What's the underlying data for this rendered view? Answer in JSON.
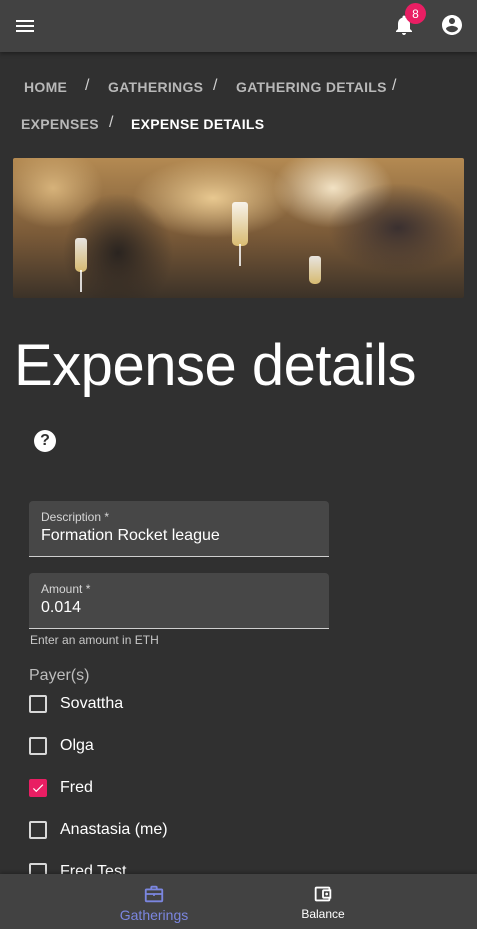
{
  "app": {
    "notification_count": "8"
  },
  "breadcrumb": [
    {
      "label": "HOME"
    },
    {
      "label": "GATHERINGS"
    },
    {
      "label": "GATHERING DETAILS"
    },
    {
      "label": "EXPENSES"
    },
    {
      "label": "EXPENSE DETAILS"
    }
  ],
  "breadcrumb_separator": "/",
  "page": {
    "title": "Expense details",
    "help_glyph": "?"
  },
  "form": {
    "description": {
      "label": "Description *",
      "value": "Formation Rocket league"
    },
    "amount": {
      "label": "Amount *",
      "value": "0.014",
      "hint": "Enter an amount in ETH"
    },
    "payers_label": "Payer(s)",
    "payers": [
      {
        "name": "Sovattha",
        "checked": false
      },
      {
        "name": "Olga",
        "checked": false
      },
      {
        "name": "Fred",
        "checked": true
      },
      {
        "name": "Anastasia (me)",
        "checked": false
      },
      {
        "name": "Fred Test",
        "checked": false
      }
    ]
  },
  "bottom_nav": {
    "gatherings": {
      "label": "Gatherings",
      "active": true
    },
    "balance": {
      "label": "Balance",
      "active": false
    }
  },
  "colors": {
    "accent": "#e91e63",
    "nav_active": "#7b86e0",
    "background": "#303030",
    "bar": "#424242"
  },
  "icons": {
    "menu": "menu-icon",
    "notifications": "bell-icon",
    "account": "account-circle-icon",
    "help": "help-circle-icon",
    "gatherings": "briefcase-icon",
    "balance": "wallet-icon"
  }
}
